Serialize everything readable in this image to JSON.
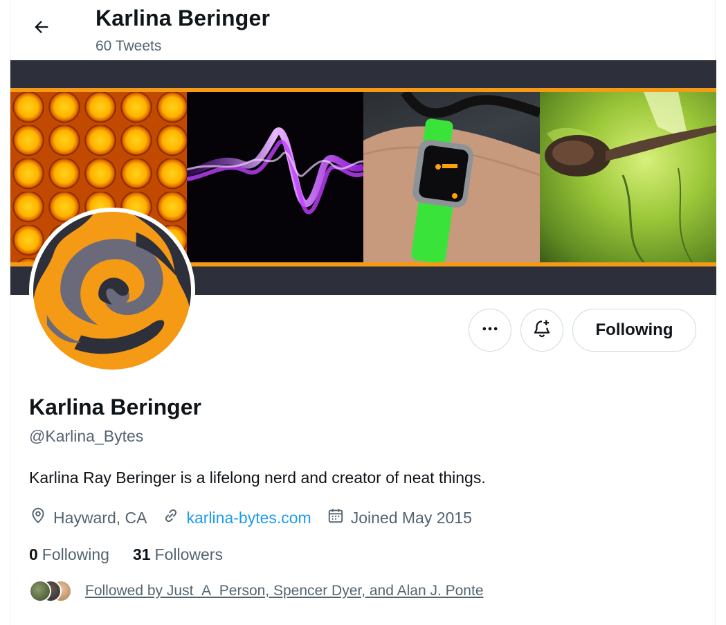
{
  "header": {
    "name": "Karlina Beringer",
    "tweet_count": "60 Tweets"
  },
  "actions": {
    "following_label": "Following"
  },
  "profile": {
    "display_name": "Karlina Beringer",
    "handle": "@Karlina_Bytes",
    "bio": "Karlina Ray Beringer is a lifelong nerd and creator of neat things.",
    "location": "Hayward, CA",
    "website": "karlina-bytes.com",
    "joined": "Joined May 2015",
    "following_count": "0",
    "following_label": "Following",
    "followers_count": "31",
    "followers_label": "Followers",
    "followed_by": "Followed by Just_A_Person, Spencer Dyer, and Alan J. Ponte"
  },
  "icons": {
    "back": "arrow-left-icon",
    "more": "more-horizontal-icon",
    "notify": "bell-plus-icon",
    "location": "location-pin-icon",
    "link": "link-icon",
    "calendar": "calendar-icon"
  },
  "colors": {
    "accent": "#1d9bf0",
    "secondary_text": "#536471",
    "primary_text": "#0f1419",
    "banner_strip": "#f59a14",
    "banner_bg": "#2d2f3a",
    "avatar_orange": "#f59a14",
    "avatar_dark": "#2d2f3a",
    "avatar_gray": "#6b6a7a"
  }
}
